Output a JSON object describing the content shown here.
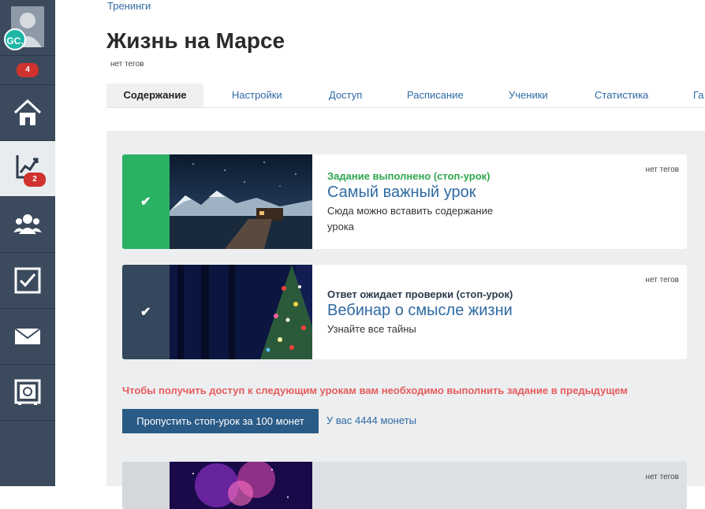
{
  "sidebar": {
    "user_initials": "GC.",
    "notifications_count": "4",
    "items": [
      {
        "name": "home",
        "icon": "home-icon"
      },
      {
        "name": "trainings",
        "icon": "chart-growth-icon",
        "badge": "2",
        "active": true
      },
      {
        "name": "users",
        "icon": "users-icon"
      },
      {
        "name": "tasks",
        "icon": "checkbox-icon"
      },
      {
        "name": "messages",
        "icon": "envelope-icon"
      },
      {
        "name": "safe",
        "icon": "safe-icon"
      }
    ]
  },
  "breadcrumb": "Тренинги",
  "page_title": "Жизнь на Марсе",
  "tags_label": "нет тегов",
  "tabs": [
    {
      "label": "Содержание",
      "active": true
    },
    {
      "label": "Настройки"
    },
    {
      "label": "Доступ"
    },
    {
      "label": "Расписание"
    },
    {
      "label": "Ученики"
    },
    {
      "label": "Статистика"
    },
    {
      "label": "Га"
    }
  ],
  "lessons": [
    {
      "status": "Задание выполнено (стоп-урок)",
      "status_color": "#2fa84f",
      "strip_color": "#2bb163",
      "title": "Самый важный урок",
      "description": "Сюда можно вставить содержание урока",
      "tags": "нет тегов",
      "thumbnail": "mountain-lake-night-image"
    },
    {
      "status": "Ответ ожидает проверки (стоп-урок)",
      "status_color": "#2b3a4c",
      "strip_color": "#34475c",
      "title": "Вебинар о смысле жизни",
      "description": "Узнайте все тайны",
      "tags": "нет тегов",
      "thumbnail": "christmas-tree-image"
    },
    {
      "tags": "нет тегов",
      "thumbnail": "nebula-image"
    }
  ],
  "stop_lesson_warning": "Чтобы получить доступ к следующим урокам вам необходимо выполнить задание  в предыдущем",
  "skip_button_label": "Пропустить стоп-урок за 100 монет",
  "coins_text": "У вас 4444 монеты",
  "colors": {
    "sidebar_bg": "#3b4a5c",
    "link": "#2f6aa3",
    "badge_red": "#d0322e",
    "warning": "#e65c5c",
    "button": "#2a5b86"
  }
}
